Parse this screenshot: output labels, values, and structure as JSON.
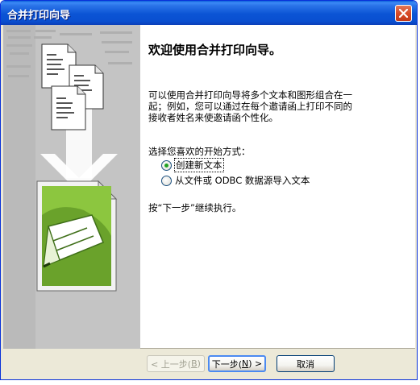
{
  "window": {
    "title": "合并打印向导"
  },
  "main": {
    "heading": "欢迎使用合并打印向导。",
    "description_line1": "可以使用合并打印向导将多个文本和图形组合在一",
    "description_line2": "起；例如，您可以通过在每个邀请函上打印不同的",
    "description_line3": "接收者姓名来使邀请函个性化。",
    "choose_label": "选择您喜欢的开始方式：",
    "options": [
      {
        "label": "创建新文本",
        "checked": true
      },
      {
        "label": "从文件或 ODBC 数据源导入文本",
        "checked": false
      }
    ],
    "hint": "按“下一步”继续执行。"
  },
  "buttons": {
    "prev_label": "< 上一步(",
    "prev_key": "B",
    "next_label": "下一步(",
    "next_key": "N",
    "next_suffix": ") >",
    "cancel_label": "取消"
  },
  "colors": {
    "titlebar": "#0b54d5",
    "dialog_bg": "#ece9d8",
    "radio_dot": "#21a121",
    "arrow_green": "#8cc63f"
  },
  "icons": {
    "close": "close-icon",
    "art": "wizard-illustration"
  }
}
